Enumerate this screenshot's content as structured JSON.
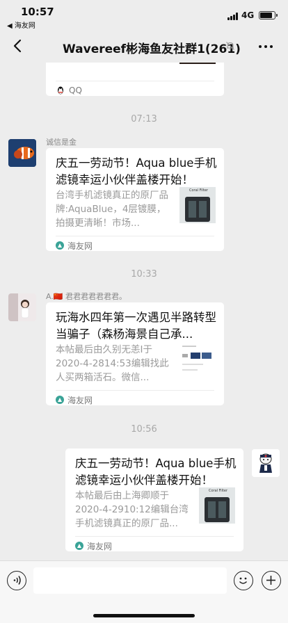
{
  "status_bar": {
    "time": "10:57",
    "back_app": "◀ 海友网",
    "network": "4G"
  },
  "nav": {
    "title": "Wavereef彬海鱼友社群1(261)",
    "back_icon": "chevron-left-icon",
    "mute_icon": "bell-off-icon",
    "more_icon": "more-icon"
  },
  "messages": [
    {
      "type": "card-partial",
      "source_name": "QQ"
    },
    {
      "timestamp": "07:13",
      "sender": "诚信是金",
      "title": "庆五一劳动节！Aqua blue手机滤镜幸运小伙伴盖楼开始！",
      "desc": "台湾手机滤镜真正的原厂品牌:AquaBlue，4层镀膜，拍摄更清晰！市场...",
      "thumb_label": "Coral Filter",
      "source_name": "海友网"
    },
    {
      "timestamp": "10:33",
      "sender": "A.🇨🇳 君君君君君君君。",
      "title": "玩海水四年第一次遇见半路转型当骗子（森杨海景自己承...",
      "desc": "本帖最后由久别无恙I于2020-4-2814:53编辑找此人买两箱活石。微信...",
      "source_name": "海友网"
    },
    {
      "timestamp": "10:56",
      "sender": "",
      "title": "庆五一劳动节！Aqua blue手机滤镜幸运小伙伴盖楼开始！",
      "desc": "本帖最后由上海卿顺于2020-4-2910:12编辑台湾手机滤镜真正的原厂品...",
      "thumb_label": "Coral Filter",
      "source_name": "海友网"
    }
  ],
  "input_bar": {
    "voice_icon": "voice-icon",
    "emoji_icon": "emoji-icon",
    "plus_icon": "plus-icon"
  }
}
